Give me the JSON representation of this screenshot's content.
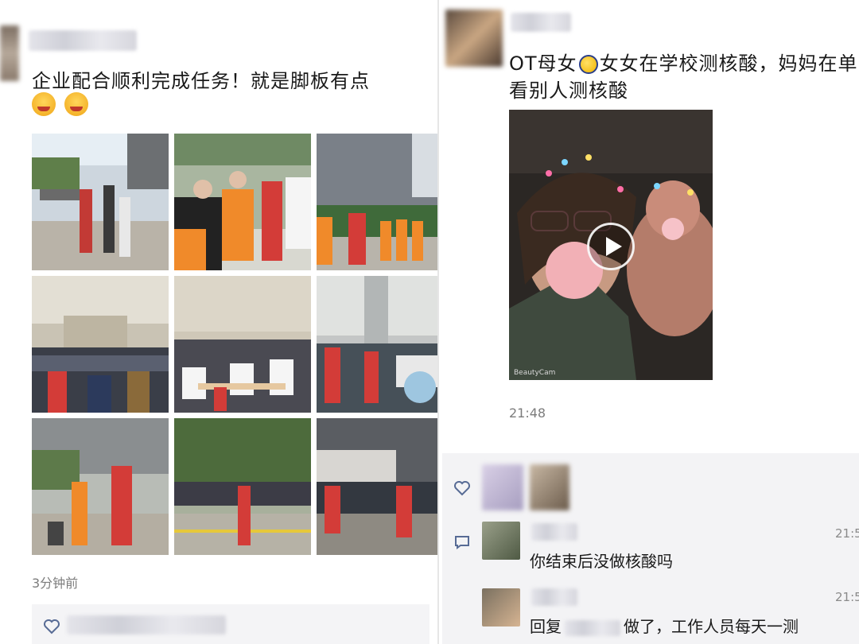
{
  "left_post": {
    "text": "企业配合顺利完成任务！就是脚板有点",
    "emojis": [
      "crying-laughing-emoji",
      "crying-laughing-emoji"
    ],
    "time": "3分钟前",
    "photo_count": 9
  },
  "right_post": {
    "text_line1": "OT母女",
    "text_line1_rest": "女女在学校测核酸，妈妈在单",
    "text_line2": "看别人测核酸",
    "video_watermark": "BeautyCam",
    "time": "21:48"
  },
  "comments": [
    {
      "text": "你结束后没做核酸吗",
      "time": "21:5"
    },
    {
      "reply_prefix": "回复",
      "text": "做了，工作人员每天一测",
      "time": "21:5"
    }
  ],
  "icons": {
    "like": "heart-icon",
    "comment": "comment-bubble-icon"
  },
  "colors": {
    "meta_gray": "#7c7c7c",
    "link_blue": "#576b95",
    "comment_bg": "#f3f3f5"
  }
}
